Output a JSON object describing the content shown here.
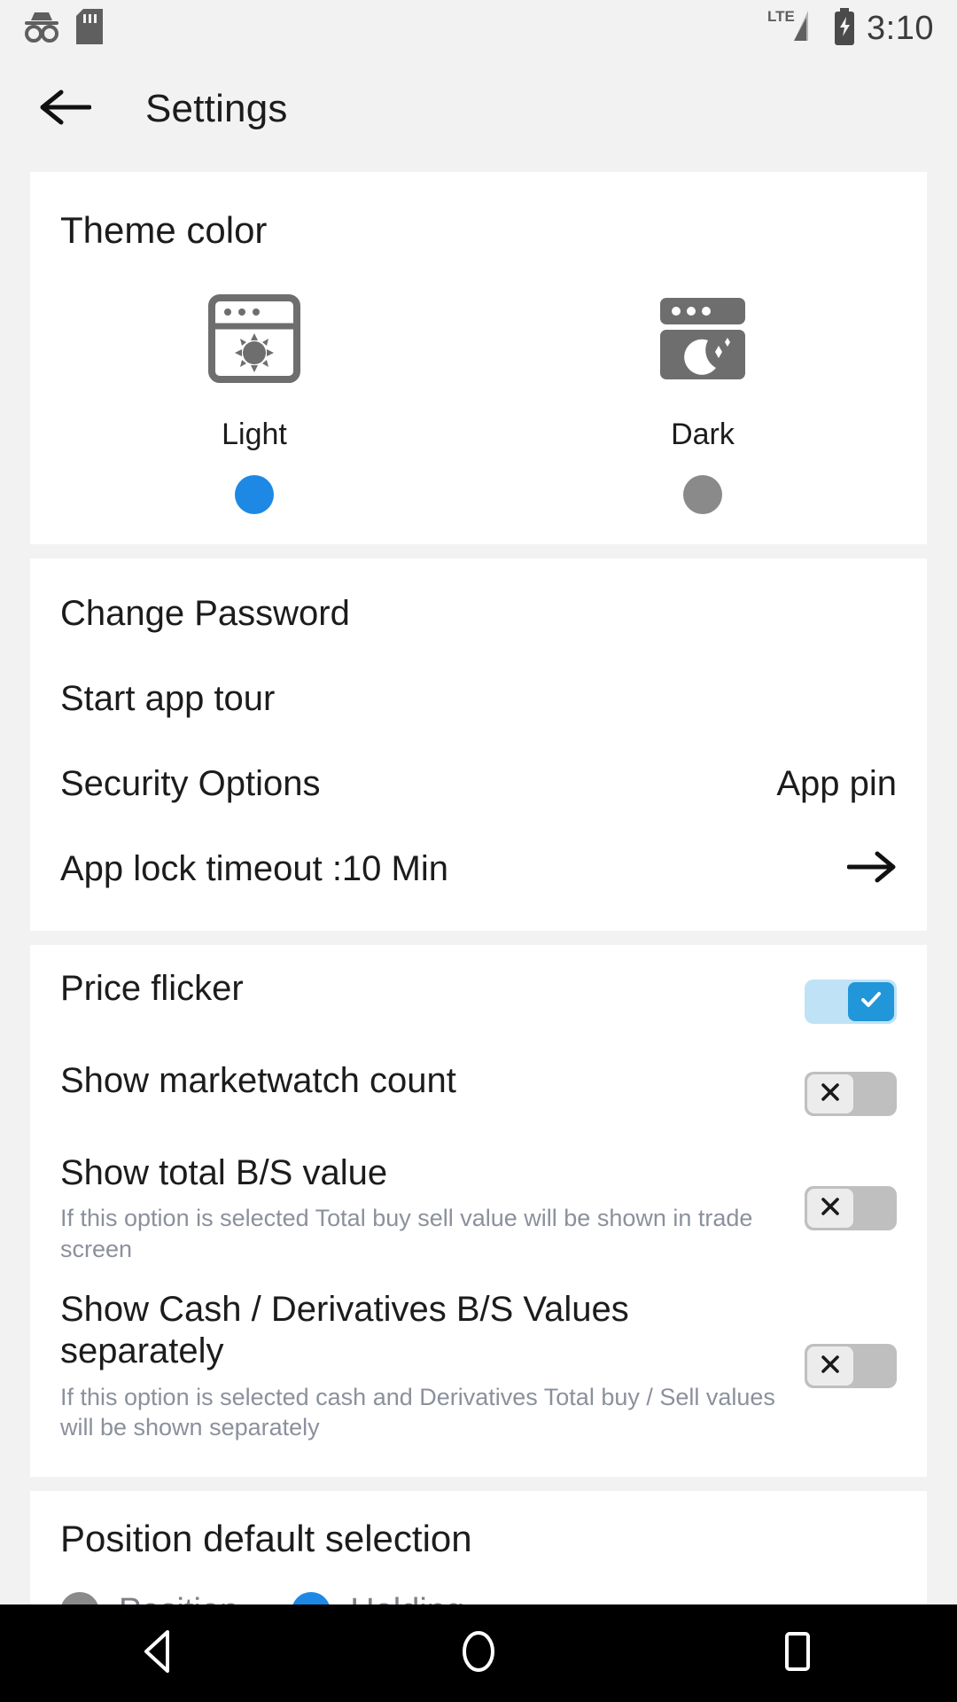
{
  "status_bar": {
    "icons_left": [
      "incognito-icon",
      "sd-card-icon"
    ],
    "icons_right": [
      "lte-signal-icon",
      "battery-charging-icon"
    ],
    "network_label": "LTE",
    "time": "3:10"
  },
  "app_bar": {
    "back_icon": "arrow-left-icon",
    "title": "Settings"
  },
  "theme": {
    "title": "Theme color",
    "options": [
      {
        "label": "Light",
        "icon": "light-theme-window-icon",
        "selected": true
      },
      {
        "label": "Dark",
        "icon": "dark-theme-window-icon",
        "selected": false
      }
    ]
  },
  "menu": {
    "items": [
      {
        "label": "Change Password",
        "value": ""
      },
      {
        "label": "Start app tour",
        "value": ""
      },
      {
        "label": "Security Options",
        "value": "App pin"
      },
      {
        "label": "App lock timeout :10 Min",
        "value": "",
        "trailing_icon": "arrow-right-icon"
      }
    ]
  },
  "toggles": {
    "items": [
      {
        "title": "Price flicker",
        "subtitle": "",
        "state": "on",
        "glyph": "check-icon"
      },
      {
        "title": "Show marketwatch count",
        "subtitle": "",
        "state": "off",
        "glyph": "close-icon"
      },
      {
        "title": "Show total B/S value",
        "subtitle": "If this option is selected Total buy sell value will be shown in trade screen",
        "state": "off",
        "glyph": "close-icon"
      },
      {
        "title": "Show Cash / Derivatives B/S Values separately",
        "subtitle": "If this option is selected cash and Derivatives Total buy / Sell values will be shown separately",
        "state": "off",
        "glyph": "close-icon"
      }
    ]
  },
  "position_default": {
    "title": "Position default selection",
    "options": [
      {
        "label": "Position",
        "selected": false
      },
      {
        "label": "Holding",
        "selected": true
      }
    ]
  },
  "nav_bar": {
    "buttons": [
      "back-triangle-icon",
      "home-circle-icon",
      "recents-square-icon"
    ]
  },
  "colors": {
    "accent": "#1e88e5",
    "toggle_on_track": "#bfe2f7",
    "toggle_on_thumb": "#2196d9",
    "toggle_off_track": "#bfbfbf",
    "toggle_off_thumb": "#ececec",
    "icon_gray": "#6e6e6e",
    "subtitle_gray": "#8b909c",
    "page_bg": "#f2f2f2",
    "card_bg": "#ffffff"
  }
}
